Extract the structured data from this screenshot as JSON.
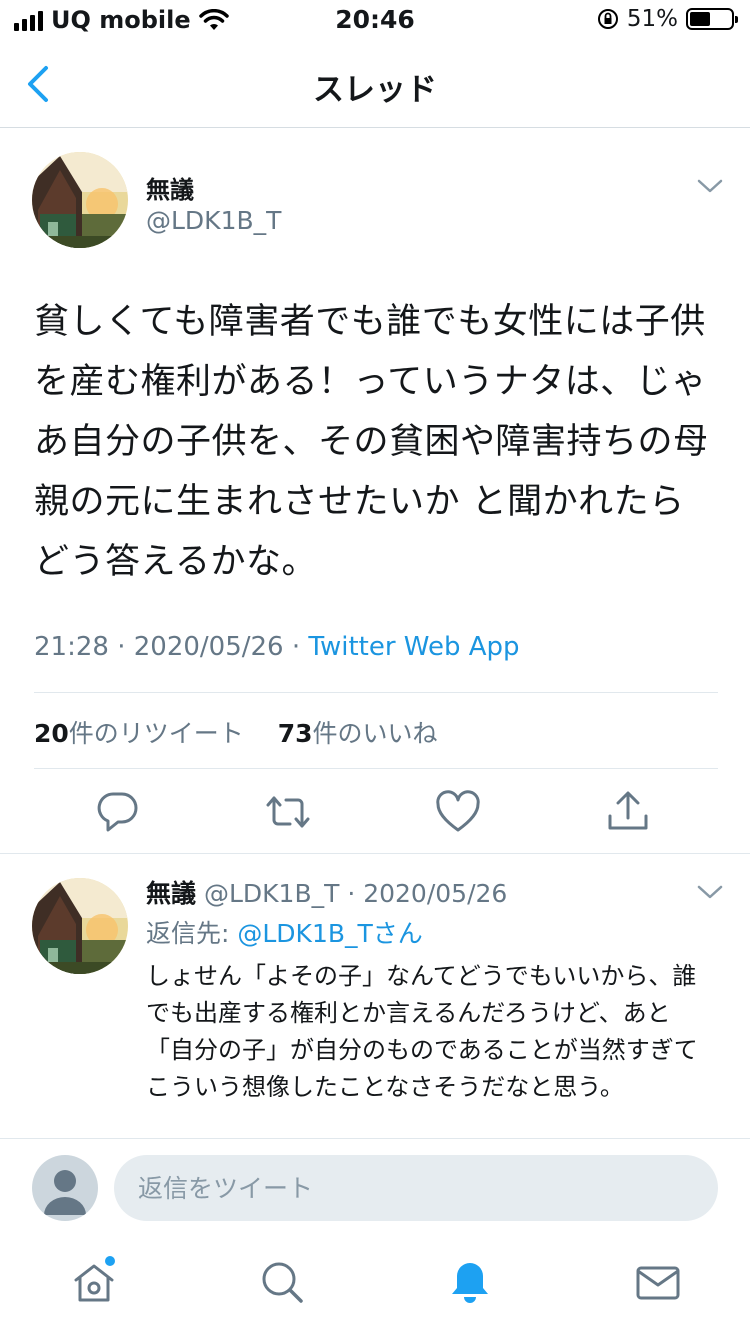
{
  "status_bar": {
    "carrier": "UQ mobile",
    "time": "20:46",
    "battery_text": "51%",
    "battery_level": 0.51
  },
  "nav": {
    "title": "スレッド",
    "back_icon": "chevron-left-icon"
  },
  "main_tweet": {
    "name": "無議",
    "handle": "@LDK1B_T",
    "text": "貧しくても障害者でも誰でも女性には子供を産む権利がある！っていうナタは、じゃあ自分の子供を、その貧困や障害持ちの母親の元に生まれさせたいか と聞かれたらどう答えるかな。",
    "time": "21:28",
    "date": "2020/05/26",
    "source": "Twitter Web App",
    "retweet_count": "20",
    "retweet_label": "件のリツイート",
    "like_count": "73",
    "like_label": "件のいいね"
  },
  "reply": {
    "name": "無議",
    "handle": "@LDK1B_T",
    "date": "2020/05/26",
    "reply_to_label": "返信先: ",
    "reply_to_handle": "@LDK1B_Tさん",
    "text": "しょせん「よその子」なんてどうでもいいから、誰でも出産する権利とか言えるんだろうけど、あと「自分の子」が自分のものであることが当然すぎてこういう想像したことなさそうだなと思う。"
  },
  "composer": {
    "placeholder": "返信をツイート"
  },
  "colors": {
    "accent": "#1da1f2",
    "link": "#1b95e0",
    "secondary_text": "#657786"
  }
}
